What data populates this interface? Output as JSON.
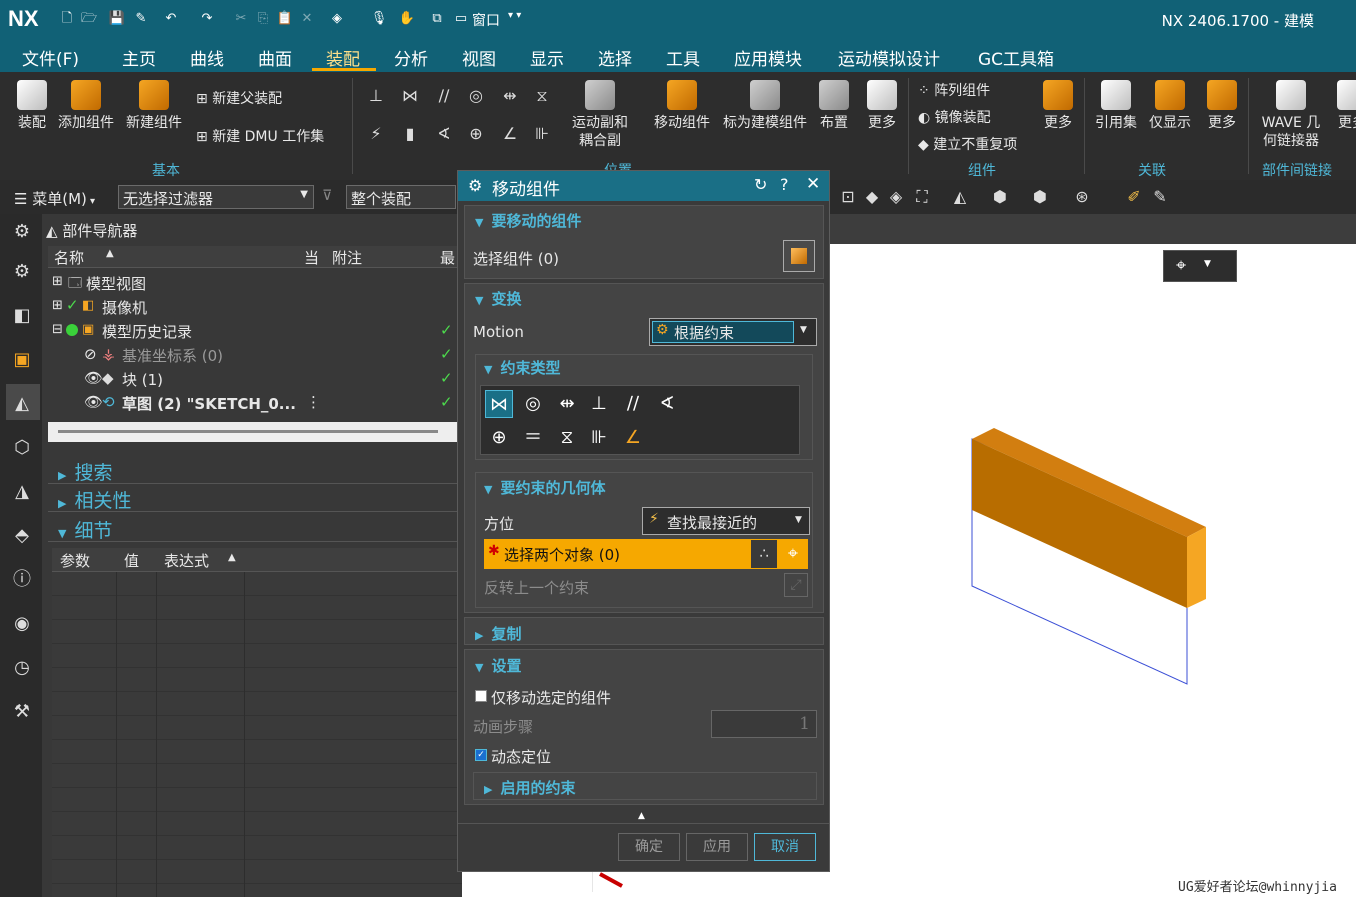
{
  "app": {
    "logo": "NX",
    "title": "NX 2406.1700 - 建模",
    "window_menu": "窗口"
  },
  "menu": [
    "文件(F)",
    "主页",
    "曲线",
    "曲面",
    "装配",
    "分析",
    "视图",
    "显示",
    "选择",
    "工具",
    "应用模块",
    "运动模拟设计",
    "GC工具箱"
  ],
  "active_menu": "装配",
  "ribbon": {
    "basic": {
      "items": [
        "装配",
        "添加组件",
        "新建组件"
      ],
      "new_parent": "新建父装配",
      "new_dmu": "新建 DMU 工作集",
      "group": "基本"
    },
    "position": {
      "motion_pair": "运动副和\n耦合副",
      "move": "移动组件",
      "mark": "标为建模组件",
      "layout": "布置",
      "more": "更多",
      "group": "位置"
    },
    "component": {
      "array": "阵列组件",
      "mirror": "镜像装配",
      "non_repeat": "建立不重复项",
      "more": "更多",
      "group": "组件"
    },
    "relation": {
      "refset": "引用集",
      "show_only": "仅显示",
      "more": "更多",
      "group": "关联"
    },
    "wave": {
      "wave": "WAVE 几\n何链接器",
      "more": "更多",
      "group": "部件间链接"
    }
  },
  "toolbar2": {
    "menu": "菜单(M)",
    "filter": "无选择过滤器",
    "scope": "整个装配"
  },
  "nav": {
    "title": "部件导航器",
    "columns": [
      "名称",
      "当",
      "附注",
      "最"
    ],
    "rows": [
      {
        "label": "模型视图",
        "check": false,
        "indent": 0
      },
      {
        "label": "摄像机",
        "check": false,
        "indent": 0
      },
      {
        "label": "模型历史记录",
        "check": true,
        "indent": 0
      },
      {
        "label": "基准坐标系 (0)",
        "check": true,
        "indent": 1,
        "dim": true
      },
      {
        "label": "块 (1)",
        "check": true,
        "indent": 1
      },
      {
        "label": "草图 (2) \"SKETCH_0...",
        "check": true,
        "indent": 1,
        "bold": true
      }
    ],
    "sections": [
      "搜索",
      "相关性",
      "细节"
    ],
    "detail_columns": [
      "参数",
      "值",
      "表达式"
    ]
  },
  "dialog": {
    "title": "移动组件",
    "sec_components": "要移动的组件",
    "select_components": "选择组件 (0)",
    "sec_transform": "变换",
    "motion_label": "Motion",
    "motion_value": "根据约束",
    "sec_constraint_type": "约束类型",
    "sec_geometry": "要约束的几何体",
    "orientation_label": "方位",
    "orientation_value": "查找最接近的",
    "select_two": "选择两个对象 (0)",
    "reverse": "反转上一个约束",
    "sec_copy": "复制",
    "sec_settings": "设置",
    "only_selected": "仅移动选定的组件",
    "anim_label": "动画步骤",
    "anim_value": "1",
    "dynamic": "动态定位",
    "enabled_constraints": "启用的约束",
    "ok": "确定",
    "apply": "应用",
    "cancel": "取消"
  },
  "watermark": "UG爱好者论坛@whinnyjia",
  "colors": {
    "title": "#116176",
    "accent": "#4fb8d8",
    "orange": "#f5a623",
    "selection": "#f6a800"
  }
}
